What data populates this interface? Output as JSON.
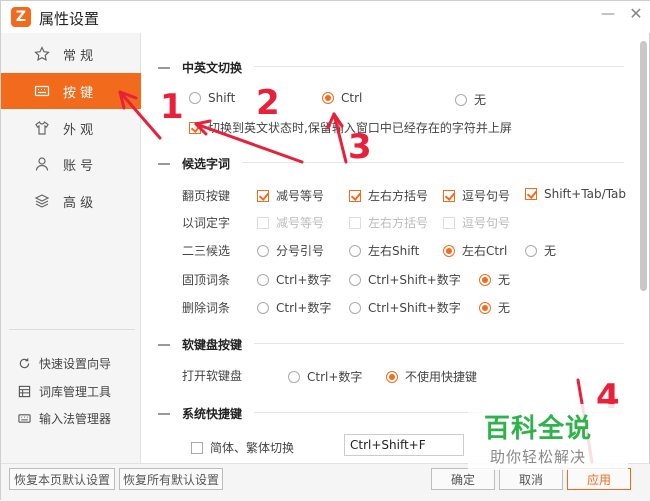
{
  "window": {
    "logo_letter": "Z",
    "title": "属性设置",
    "minimize_glyph": "—",
    "close_glyph": "✕"
  },
  "sidebar": {
    "items": [
      {
        "label": "常 规",
        "icon": "star-icon"
      },
      {
        "label": "按 键",
        "icon": "keyboard-icon",
        "active": true
      },
      {
        "label": "外 观",
        "icon": "shirt-icon"
      },
      {
        "label": "账 号",
        "icon": "user-icon"
      },
      {
        "label": "高 级",
        "icon": "layers-icon"
      }
    ],
    "tools": [
      {
        "label": "快速设置向导",
        "icon": "refresh-icon"
      },
      {
        "label": "词库管理工具",
        "icon": "grid-icon"
      },
      {
        "label": "输入法管理器",
        "icon": "keyboard-icon"
      }
    ]
  },
  "sections": {
    "switch": {
      "title": "中英文切换",
      "options": [
        "Shift",
        "Ctrl",
        "无"
      ],
      "selected": "Ctrl",
      "retain_label": "切换到英文状态时,保留输入窗口中已经存在的字符并上屏",
      "retain_checked": true
    },
    "candidates": {
      "title": "候选字词",
      "rows": [
        {
          "label": "翻页按键",
          "type": "check",
          "options": [
            {
              "text": "减号等号",
              "checked": true
            },
            {
              "text": "左右方括号",
              "checked": true
            },
            {
              "text": "逗号句号",
              "checked": true
            },
            {
              "text": "Shift+Tab/Tab",
              "checked": true
            }
          ]
        },
        {
          "label": "以词定字",
          "type": "check-disabled",
          "options": [
            {
              "text": "减号等号",
              "checked": false
            },
            {
              "text": "左右方括号",
              "checked": false
            },
            {
              "text": "逗号句号",
              "checked": false
            }
          ]
        },
        {
          "label": "二三候选",
          "type": "radio",
          "options": [
            {
              "text": "分号引号",
              "checked": false
            },
            {
              "text": "左右Shift",
              "checked": false
            },
            {
              "text": "左右Ctrl",
              "checked": true
            },
            {
              "text": "无",
              "checked": false
            }
          ]
        },
        {
          "label": "固顶词条",
          "type": "radio",
          "options": [
            {
              "text": "Ctrl+数字",
              "checked": false
            },
            {
              "text": "Ctrl+Shift+数字",
              "checked": false
            },
            {
              "text": "无",
              "checked": true
            }
          ]
        },
        {
          "label": "删除词条",
          "type": "radio",
          "options": [
            {
              "text": "Ctrl+数字",
              "checked": false
            },
            {
              "text": "Ctrl+Shift+数字",
              "checked": false
            },
            {
              "text": "无",
              "checked": true
            }
          ]
        }
      ]
    },
    "softkeyboard": {
      "title": "软键盘按键",
      "row_label": "打开软键盘",
      "options": [
        {
          "text": "Ctrl+数字",
          "checked": false
        },
        {
          "text": "不使用快捷键",
          "checked": true
        }
      ]
    },
    "system": {
      "title": "系统快捷键",
      "row": {
        "text": "简体、繁体切换",
        "checked": false,
        "hotkey": "Ctrl+Shift+F"
      }
    }
  },
  "footer": {
    "restore_page": "恢复本页默认设置",
    "restore_all": "恢复所有默认设置",
    "ok": "确定",
    "cancel": "取消",
    "apply": "应用"
  },
  "annotations": {
    "color": "#e8203a",
    "labels": [
      "1",
      "2",
      "3",
      "4"
    ]
  },
  "watermark": {
    "title": "百科全说",
    "subtitle": "助你轻松解决",
    "color": "#2db34a"
  }
}
